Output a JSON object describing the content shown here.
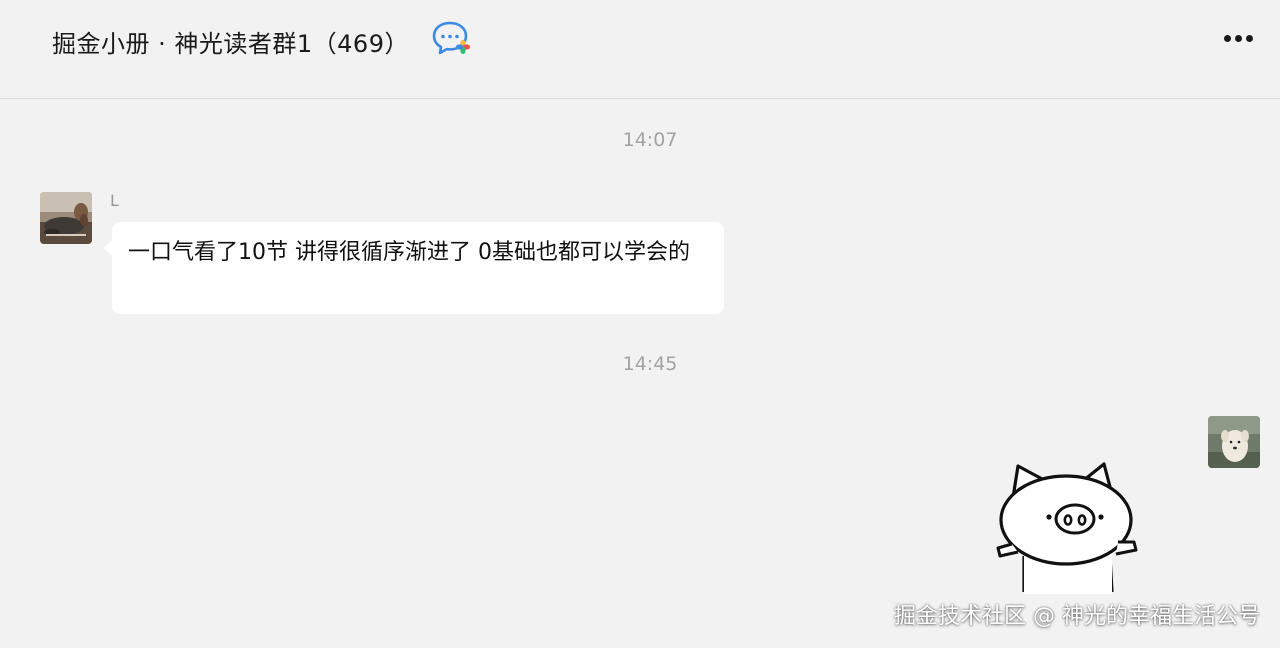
{
  "header": {
    "title": "掘金小册 · 神光读者群1（469）",
    "chat_icon": "chat-bubble-icon",
    "more_icon": "more-dots-icon"
  },
  "messages": [
    {
      "type": "time",
      "text": "14:07"
    },
    {
      "type": "incoming",
      "sender": "L",
      "avatar": "dog-avatar",
      "text": "一口气看了10节 讲得很循序渐进了 0基础也都可以学会的"
    },
    {
      "type": "time",
      "text": "14:45"
    },
    {
      "type": "outgoing",
      "avatar": "puppy-avatar",
      "sticker": "pig-sticker"
    }
  ],
  "watermark": "掘金技术社区 @ 神光的幸福生活公号",
  "colors": {
    "background": "#f2f2f2",
    "bubble": "#ffffff",
    "timestamp": "#a3a3a3",
    "chat_icon_blue": "#3d8ae5"
  }
}
